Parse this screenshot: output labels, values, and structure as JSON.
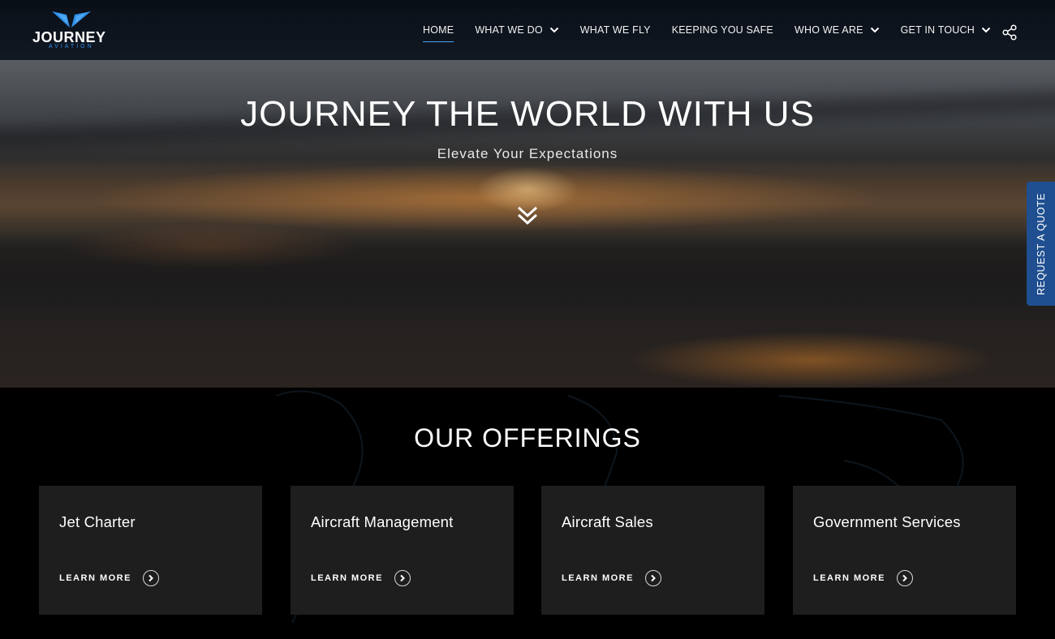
{
  "brand": {
    "name": "JOURNEY",
    "tagline": "AVIATION",
    "wing_color": "#2f8fe8"
  },
  "nav": {
    "items": [
      {
        "label": "HOME",
        "active": true,
        "dropdown": false
      },
      {
        "label": "WHAT WE DO",
        "active": false,
        "dropdown": true
      },
      {
        "label": "WHAT WE FLY",
        "active": false,
        "dropdown": false
      },
      {
        "label": "KEEPING YOU SAFE",
        "active": false,
        "dropdown": false
      },
      {
        "label": "WHO WE ARE",
        "active": false,
        "dropdown": true
      },
      {
        "label": "GET IN TOUCH",
        "active": false,
        "dropdown": true
      }
    ],
    "share_icon": "share-icon"
  },
  "hero": {
    "title": "JOURNEY THE WORLD WITH US",
    "subtitle": "Elevate Your Expectations",
    "scroll_icon": "double-chevron-down-icon"
  },
  "quote_tab": {
    "label": "REQUEST A QUOTE",
    "color": "#1f4f90"
  },
  "offerings": {
    "title": "OUR OFFERINGS",
    "cards": [
      {
        "title": "Jet Charter",
        "link": "LEARN MORE"
      },
      {
        "title": "Aircraft Management",
        "link": "LEARN MORE"
      },
      {
        "title": "Aircraft Sales",
        "link": "LEARN MORE"
      },
      {
        "title": "Government Services",
        "link": "LEARN MORE"
      }
    ]
  }
}
